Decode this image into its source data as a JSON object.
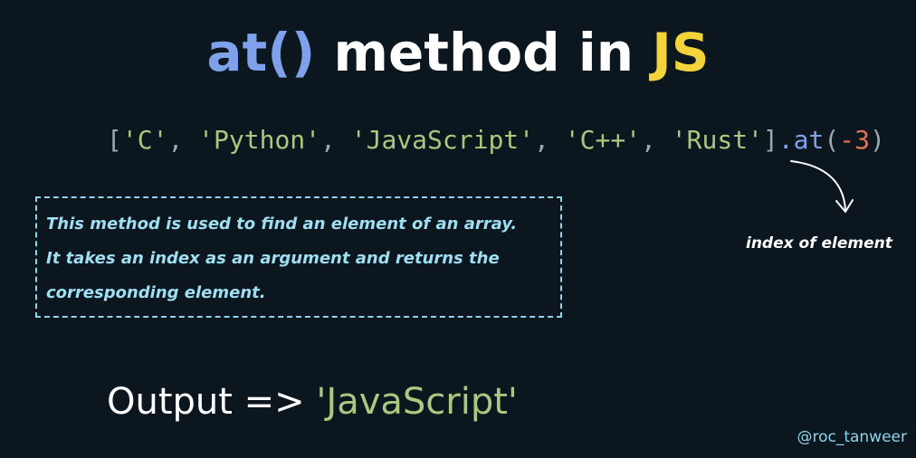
{
  "title": {
    "part1": "at()",
    "part2": " method in ",
    "part3": "JS"
  },
  "code": {
    "open_bracket": "[",
    "items": [
      "'C'",
      "'Python'",
      "'JavaScript'",
      "'C++'",
      "'Rust'"
    ],
    "separator": ", ",
    "close_bracket": "]",
    "method": ".at",
    "paren_open": "(",
    "argument": "-3",
    "paren_close": ")"
  },
  "description": {
    "lines": [
      "This method is used to find an element of an array.",
      "It takes an index as an argument and returns the",
      "corresponding element."
    ]
  },
  "annotation": {
    "text": "index of element"
  },
  "output": {
    "label": "Output => ",
    "value": "'JavaScript'"
  },
  "handle": "@roc_tanweer",
  "colors": {
    "background": "#0c161f",
    "method_blue": "#7fa1eb",
    "js_yellow": "#f2d43a",
    "string_green": "#a8c97f",
    "bracket_gray": "#9ea7b0",
    "number_orange": "#e0744f",
    "text_white": "#ffffff",
    "accent_cyan": "#8fd4ec"
  }
}
